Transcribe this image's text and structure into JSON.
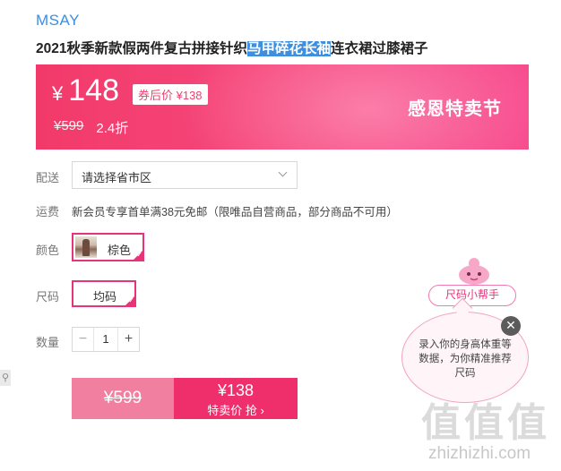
{
  "product": {
    "brand": "MSAY",
    "title_before": "2021秋季新款假两件复古拼接针织",
    "title_highlight": "马甲碎花长袖",
    "title_after": "连衣裙过膝裙子"
  },
  "price": {
    "currency": "¥",
    "current": "148",
    "coupon_label": "券后价 ¥138",
    "original": "¥599",
    "discount": "2.4折",
    "promo_text": "感恩特卖节"
  },
  "delivery": {
    "label": "配送",
    "select_value": "请选择省市区"
  },
  "shipping": {
    "label": "运费",
    "text": "新会员专享首单满38元免邮（限唯品自营商品，部分商品不可用）"
  },
  "color": {
    "label": "颜色",
    "selected": "棕色"
  },
  "size": {
    "label": "尺码",
    "selected": "均码"
  },
  "quantity": {
    "label": "数量",
    "value": "1",
    "minus": "−",
    "plus": "+"
  },
  "buy": {
    "original_price": "¥599",
    "special_price": "¥138",
    "special_label": "特卖价 抢 ›"
  },
  "size_helper": {
    "pill_label": "尺码小帮手",
    "bubble_text": "录入你的身高体重等数据，为你精准推荐尺码",
    "close_glyph": "✕"
  },
  "watermark": {
    "big": "值值值",
    "small": "zhizhizhi.com"
  },
  "colors": {
    "accent": "#ee2f6c",
    "brand_link": "#3a8ee6",
    "selection": "#e8337a"
  },
  "icons": [
    "chevron-down-icon",
    "check-icon",
    "close-icon",
    "search-icon",
    "mascot-icon"
  ]
}
